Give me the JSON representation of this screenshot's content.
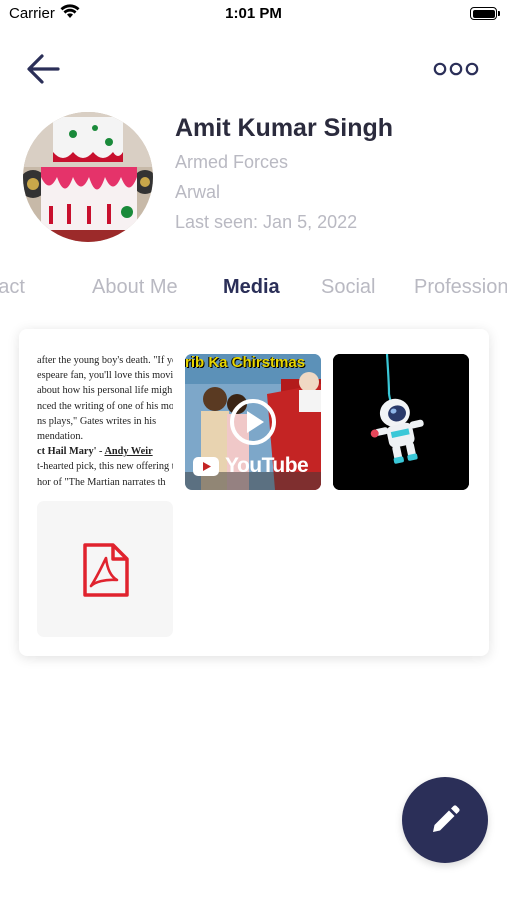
{
  "status": {
    "carrier": "Carrier",
    "time": "1:01 PM"
  },
  "header": {
    "back_icon": "arrow-left-icon",
    "more_icon": "more-horizontal-icon"
  },
  "profile": {
    "name": "Amit Kumar Singh",
    "line1": "Armed Forces",
    "line2": "Arwal",
    "line3": "Last seen: Jan 5, 2022"
  },
  "tabs": [
    "Contact",
    "About Me",
    "Media",
    "Social",
    "Professional"
  ],
  "active_tab": "Media",
  "media": {
    "article": {
      "l1": "after the young boy's death. \"If yo",
      "l2": "espeare fan, you'll love this movin",
      "l3": "about how his personal life migh",
      "l4": "nced the writing of one of his mo",
      "l5": "ns plays,\" Gates writes in his",
      "l6": "mendation.",
      "l7a": "ct Hail Mary' - ",
      "l7b": "Andy Weir",
      "l8": "t-hearted pick, this new offering t",
      "l9": "hor of \"The Martian narrates th"
    },
    "video": {
      "title": "rib Ka Chirstmas",
      "brand": "YouTube"
    },
    "pdf_icon": "pdf-file-icon"
  },
  "fab_icon": "pencil-icon",
  "colors": {
    "primary": "#2b2f58",
    "muted": "#b9b9c2",
    "text": "#2b2b3d",
    "pdf_red": "#e0232e"
  }
}
